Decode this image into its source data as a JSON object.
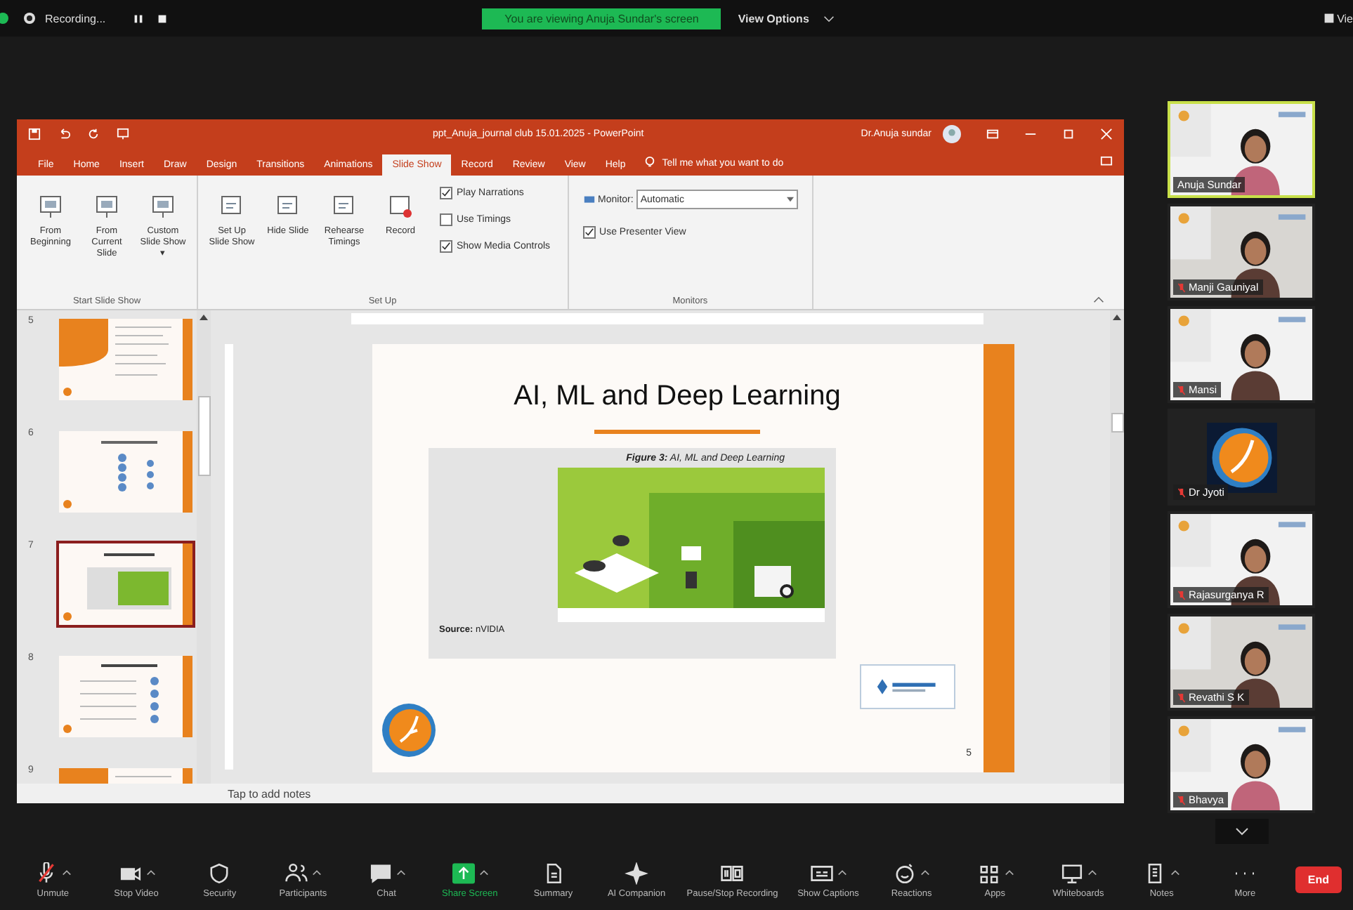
{
  "top_bar": {
    "recording": "Recording...",
    "banner": "You are viewing Anuja Sundar's screen",
    "view_options": "View Options",
    "view": "Vie"
  },
  "powerpoint": {
    "title": "ppt_Anuja_journal club 15.01.2025 - PowerPoint",
    "user": "Dr.Anuja sundar",
    "tabs": [
      {
        "label": "File",
        "selected": false
      },
      {
        "label": "Home",
        "selected": false
      },
      {
        "label": "Insert",
        "selected": false
      },
      {
        "label": "Draw",
        "selected": false
      },
      {
        "label": "Design",
        "selected": false
      },
      {
        "label": "Transitions",
        "selected": false
      },
      {
        "label": "Animations",
        "selected": false
      },
      {
        "label": "Slide Show",
        "selected": true
      },
      {
        "label": "Record",
        "selected": false
      },
      {
        "label": "Review",
        "selected": false
      },
      {
        "label": "View",
        "selected": false
      },
      {
        "label": "Help",
        "selected": false
      }
    ],
    "tell_me": "Tell me what you want to do",
    "start_group": {
      "label": "Start Slide Show",
      "buttons": [
        "From Beginning",
        "From Current Slide",
        "Custom Slide Show ▾"
      ]
    },
    "setup_group": {
      "label": "Set Up",
      "buttons": [
        "Set Up Slide Show",
        "Hide Slide",
        "Rehearse Timings",
        "Record"
      ],
      "checks": [
        {
          "label": "Play Narrations",
          "checked": true
        },
        {
          "label": "Use Timings",
          "checked": false
        },
        {
          "label": "Show Media Controls",
          "checked": true
        }
      ]
    },
    "monitors_group": {
      "label": "Monitors",
      "monitor_label": "Monitor:",
      "monitor_value": "Automatic",
      "presenter": {
        "label": "Use Presenter View",
        "checked": true
      }
    },
    "slides": [
      {
        "number": "5",
        "kind": "orange",
        "selected": false
      },
      {
        "number": "6",
        "kind": "diagram",
        "selected": false
      },
      {
        "number": "7",
        "kind": "figure",
        "selected": true
      },
      {
        "number": "8",
        "kind": "list",
        "selected": false
      },
      {
        "number": "9",
        "kind": "orange",
        "selected": false
      }
    ],
    "slide": {
      "title": "AI, ML and Deep Learning",
      "caption": "**Figure 3:** AI, ML and Deep Learning",
      "source": "**Source:** nVIDIA",
      "number": "5"
    },
    "notes_placeholder": "Tap to add notes"
  },
  "participants": [
    {
      "name": "Anuja Sundar",
      "kind": "video",
      "speaking": true,
      "muted": false
    },
    {
      "name": "Manji Gauniyal",
      "kind": "video",
      "speaking": false,
      "muted": true
    },
    {
      "name": "Mansi",
      "kind": "video",
      "speaking": false,
      "muted": true
    },
    {
      "name": "Dr Jyoti",
      "kind": "logo",
      "speaking": false,
      "muted": true
    },
    {
      "name": "Rajasurganya R",
      "kind": "video",
      "speaking": false,
      "muted": true
    },
    {
      "name": "Revathi S K",
      "kind": "video",
      "speaking": false,
      "muted": true
    },
    {
      "name": "Bhavya",
      "kind": "video",
      "speaking": false,
      "muted": true
    }
  ],
  "toolbar": [
    {
      "label": "Unmute",
      "menu": true
    },
    {
      "label": "Stop Video",
      "menu": true
    },
    {
      "label": "Security",
      "menu": false
    },
    {
      "label": "Participants",
      "menu": true
    },
    {
      "label": "Chat",
      "menu": true
    },
    {
      "label": "Share Screen",
      "menu": true
    },
    {
      "label": "Summary",
      "menu": false
    },
    {
      "label": "AI Companion",
      "menu": false
    },
    {
      "label": "Pause/Stop Recording",
      "menu": false
    },
    {
      "label": "Show Captions",
      "menu": true
    },
    {
      "label": "Reactions",
      "menu": true
    },
    {
      "label": "Apps",
      "menu": true
    },
    {
      "label": "Whiteboards",
      "menu": true
    },
    {
      "label": "Notes",
      "menu": true
    },
    {
      "label": "More",
      "menu": false
    }
  ],
  "end_button": "End"
}
